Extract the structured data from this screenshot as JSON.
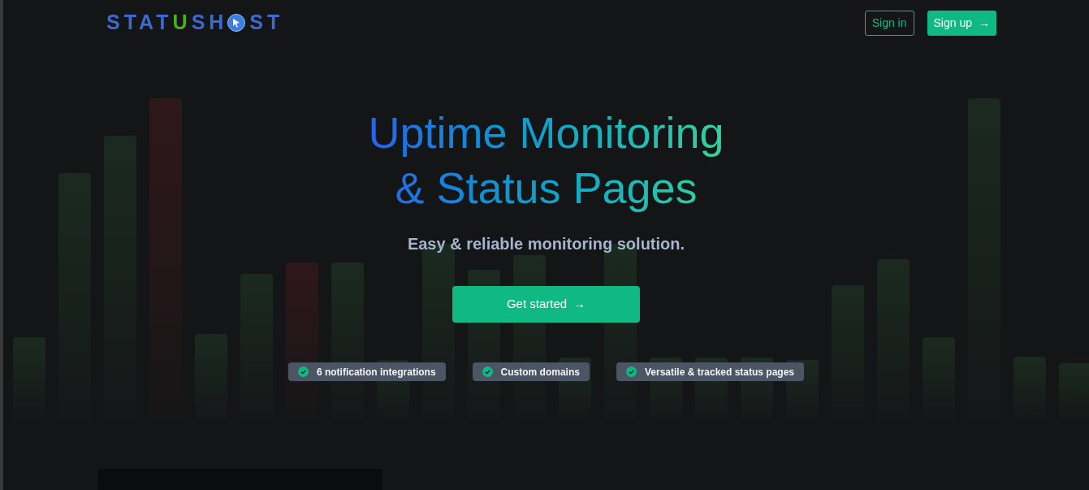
{
  "logo": {
    "parts": [
      {
        "text": "STAT",
        "color": "#3c6ad0"
      },
      {
        "text": "U",
        "color": "#4cae1c"
      },
      {
        "text": "SH",
        "color": "#3c6ad0"
      },
      {
        "kind": "globe"
      },
      {
        "text": "ST",
        "color": "#3c6ad0"
      }
    ]
  },
  "nav": {
    "sign_in": "Sign in",
    "sign_up": "Sign up",
    "sign_up_icon": "→"
  },
  "hero": {
    "title_lines": [
      "Uptime Monitoring",
      "& Status Pages"
    ],
    "subtitle": "Easy & reliable monitoring solution.",
    "cta": "Get started",
    "cta_icon": "→"
  },
  "features": [
    {
      "label": "6 notification integrations"
    },
    {
      "label": "Custom domains"
    },
    {
      "label": "Versatile & tracked status pages"
    }
  ]
}
